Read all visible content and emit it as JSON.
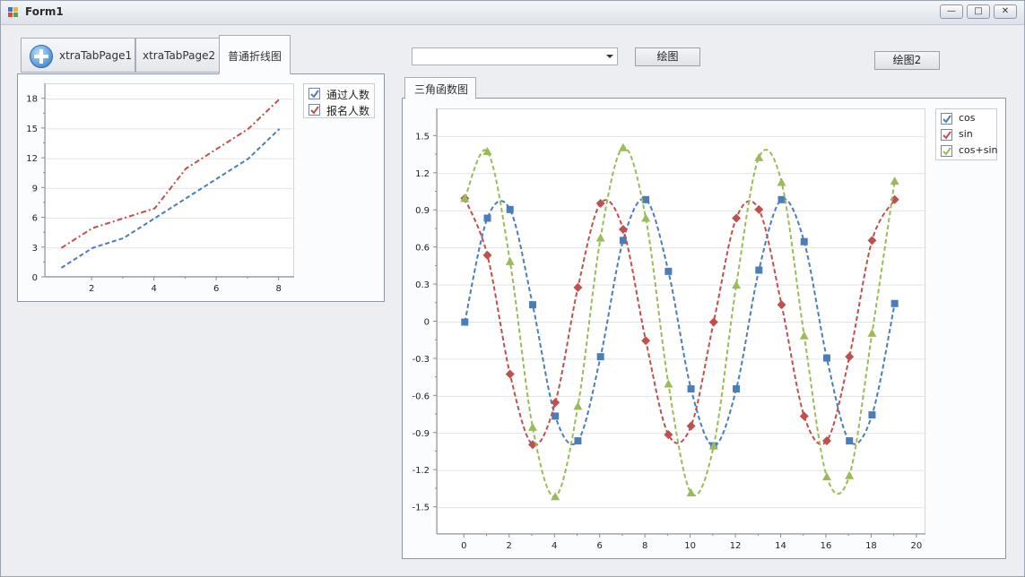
{
  "window": {
    "title": "Form1",
    "buttons": {
      "minimize": "—",
      "maximize": "□",
      "close": "✕"
    }
  },
  "tabs": [
    {
      "label": "xtraTabPage1",
      "icon": "plus-circle-icon"
    },
    {
      "label": "xtraTabPage2"
    },
    {
      "label": "普通折线图",
      "active": true
    }
  ],
  "controls": {
    "combo_value": "",
    "draw_button": "绘图",
    "draw2_button": "绘图2"
  },
  "right_tab": {
    "label": "三角函数图"
  },
  "colors": {
    "blue": "#4a7ebb",
    "red": "#c0504d",
    "green": "#9bbb59",
    "grid": "#e3e3e3",
    "axis": "#8c8c8c"
  },
  "chart_data": [
    {
      "type": "line",
      "x": [
        1,
        2,
        3,
        4,
        5,
        6,
        7,
        8
      ],
      "series": [
        {
          "name": "通过人数",
          "values": [
            1,
            3,
            4,
            6,
            8,
            10,
            12,
            15
          ],
          "style": "dashed",
          "color": "#4a7ebb"
        },
        {
          "name": "报名人数",
          "values": [
            3,
            5,
            6,
            7,
            11,
            13,
            15,
            18
          ],
          "style": "dash-dot",
          "color": "#c0504d"
        }
      ],
      "xticks": [
        "2",
        "4",
        "6",
        "8"
      ],
      "yticks": [
        "0",
        "3",
        "6",
        "9",
        "12",
        "15",
        "18"
      ],
      "xlim": [
        0.5,
        8.5
      ],
      "ylim": [
        0,
        19.5
      ],
      "grid": true,
      "legend": "top-right"
    },
    {
      "type": "line",
      "x": [
        0,
        1,
        2,
        3,
        4,
        5,
        6,
        7,
        8,
        9,
        10,
        11,
        12,
        13,
        14,
        15,
        16,
        17,
        18,
        19
      ],
      "series": [
        {
          "name": "cos",
          "marker": "square",
          "color": "#4a7ebb",
          "values": [
            0,
            0.84,
            0.91,
            0.14,
            -0.76,
            -0.96,
            -0.28,
            0.66,
            0.99,
            0.41,
            -0.54,
            -1.0,
            -0.54,
            0.42,
            0.99,
            0.65,
            -0.29,
            -0.96,
            -0.75,
            0.15
          ]
        },
        {
          "name": "sin",
          "marker": "diamond",
          "color": "#c0504d",
          "values": [
            1,
            0.54,
            -0.42,
            -0.99,
            -0.65,
            0.28,
            0.96,
            0.75,
            -0.15,
            -0.91,
            -0.84,
            0.0,
            0.84,
            0.91,
            0.14,
            -0.76,
            -0.96,
            -0.28,
            0.66,
            0.99
          ]
        },
        {
          "name": "cos+sin",
          "marker": "triangle",
          "color": "#9bbb59",
          "values": [
            1,
            1.38,
            0.49,
            -0.85,
            -1.41,
            -0.68,
            0.68,
            1.41,
            0.84,
            -0.5,
            -1.38,
            -1.0,
            0.3,
            1.33,
            1.13,
            -0.11,
            -1.25,
            -1.24,
            -0.09,
            1.14
          ]
        }
      ],
      "xticks": [
        "0",
        "2",
        "4",
        "6",
        "8",
        "10",
        "12",
        "14",
        "16",
        "18",
        "20"
      ],
      "yticks": [
        "-1.5",
        "-1.2",
        "-0.9",
        "-0.6",
        "-0.3",
        "0",
        "0.3",
        "0.6",
        "0.9",
        "1.2",
        "1.5"
      ],
      "xlim": [
        -1.2,
        20.4
      ],
      "ylim": [
        -1.72,
        1.72
      ],
      "grid": true,
      "legend": "top-right"
    }
  ]
}
